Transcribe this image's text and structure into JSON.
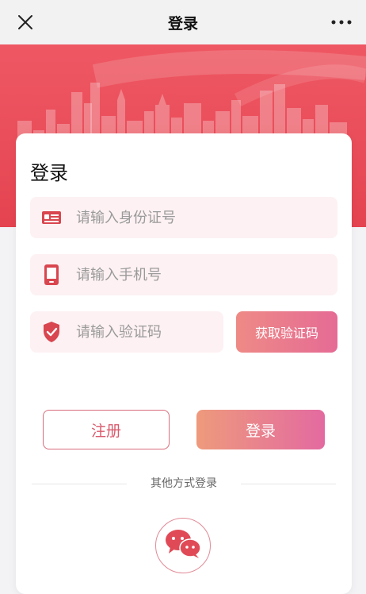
{
  "navbar": {
    "title": "登录",
    "close_icon": "close-icon",
    "more_icon": "more-horizontal-icon"
  },
  "card": {
    "title": "登录"
  },
  "form": {
    "id_number": {
      "placeholder": "请输入身份证号",
      "icon": "id-card-icon",
      "value": ""
    },
    "phone": {
      "placeholder": "请输入手机号",
      "icon": "mobile-phone-icon",
      "value": ""
    },
    "code": {
      "placeholder": "请输入验证码",
      "icon": "shield-check-icon",
      "value": ""
    },
    "get_code_label": "获取验证码"
  },
  "actions": {
    "register_label": "注册",
    "login_label": "登录"
  },
  "other_login": {
    "divider_text": "其他方式登录",
    "wechat_icon": "wechat-icon"
  },
  "colors": {
    "brand_red": "#e94c59",
    "field_bg": "#fdf1f3",
    "gradient_start": "#ee9a7c",
    "gradient_end": "#e36aa0"
  }
}
